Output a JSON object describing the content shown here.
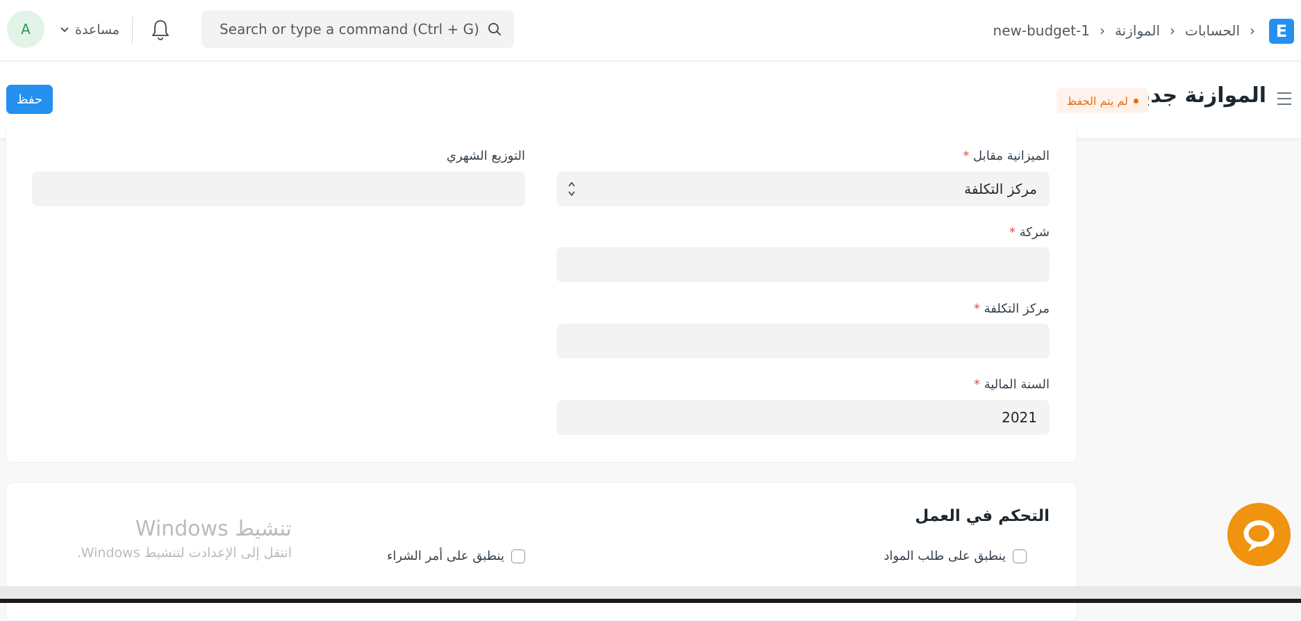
{
  "navbar": {
    "logo_letter": "E",
    "breadcrumbs": [
      "الحسابات",
      "الموازنة",
      "new-budget-1"
    ],
    "search_placeholder": "Search or type a command (Ctrl + G)",
    "help_label": "مساعدة",
    "avatar_letter": "A"
  },
  "page": {
    "title": "الموازنة جديد",
    "status_badge": "لم يتم الحفظ",
    "save_label": "حفظ"
  },
  "form": {
    "budget_against": {
      "label": "الميزانية مقابل",
      "required": "*",
      "value": "مركز التكلفة"
    },
    "monthly_distribution": {
      "label": "التوزيع الشهري",
      "value": ""
    },
    "company": {
      "label": "شركة",
      "required": "*",
      "value": ""
    },
    "cost_center": {
      "label": "مركز التكلفة",
      "required": "*",
      "value": ""
    },
    "fiscal_year": {
      "label": "السنة المالية",
      "required": "*",
      "value": "2021"
    }
  },
  "control": {
    "section_title": "التحكم في العمل",
    "applicable_material_request": "ينطبق على طلب المواد",
    "applicable_purchase_order": "ينطبق على أمر الشراء"
  },
  "watermark": {
    "line1": "تنشيط Windows",
    "line2": "انتقل إلى الإعدادت لتنشيط Windows."
  },
  "colors": {
    "primary": "#2490ef",
    "chat": "#f0930e",
    "badge": "#e86c13"
  },
  "icons": [
    "search-icon",
    "bell-icon",
    "chevron-down-icon",
    "hamburger-icon",
    "chat-icon",
    "updown-icon"
  ]
}
